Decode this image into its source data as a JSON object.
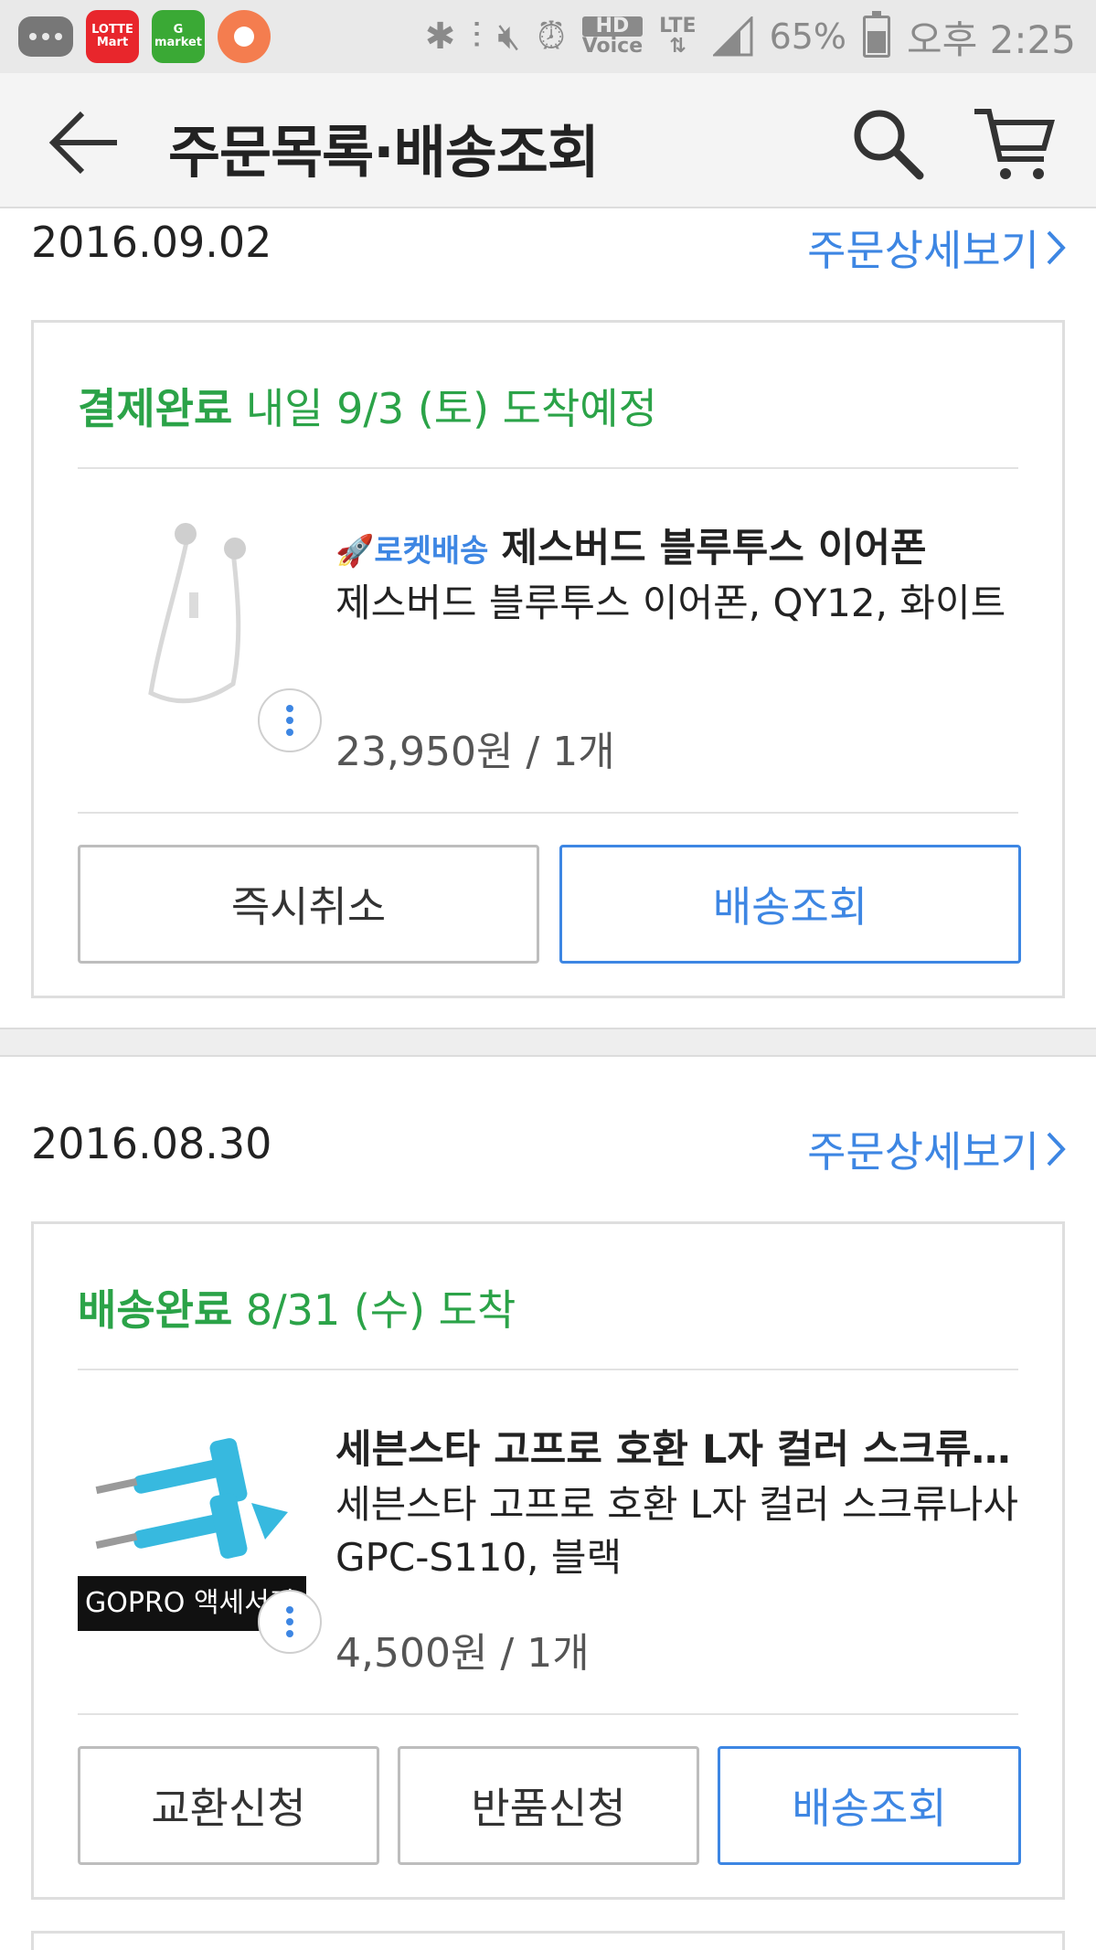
{
  "status_bar": {
    "apps": [
      {
        "name": "chat-app",
        "label": ""
      },
      {
        "name": "lotte-mart-app",
        "label": "LOTTE Mart",
        "color": "#e8262c"
      },
      {
        "name": "gmarket-app",
        "label": "G market",
        "color": "#3aa935"
      },
      {
        "name": "record-app",
        "label": "",
        "color": "#f47d4f"
      }
    ],
    "hd_label": "HD",
    "voice_label": "Voice",
    "lte_label": "LTE",
    "battery": "65%",
    "time": "오후 2:25"
  },
  "header": {
    "title": "주문목록·배송조회",
    "back_icon": "arrow-left-icon",
    "search_icon": "search-icon",
    "cart_icon": "cart-icon"
  },
  "orders": [
    {
      "date": "2016.09.02",
      "detail_link": "주문상세보기",
      "status_label": "결제완료",
      "status_text": "내일 9/3 (토) 도착예정",
      "badge": "🚀로켓배송",
      "product_title": "제스버드 블루투스 이어폰",
      "product_option": "제스버드 블루투스 이어폰, QY12, 화이트",
      "price": "23,950원 / 1개",
      "buttons": [
        "즉시취소",
        "배송조회"
      ]
    },
    {
      "date": "2016.08.30",
      "detail_link": "주문상세보기",
      "status_label": "배송완료",
      "status_text": "8/31 (수) 도착",
      "product_title": "세븐스타 고프로 호환 L자 컬러 스크류나사 GPC-S110, 블랙",
      "product_option": "세븐스타 고프로 호환 L자 컬러 스크류나사 GPC-S110, 블랙",
      "image_caption": "GOPRO 액세서리",
      "price": "4,500원 / 1개",
      "buttons": [
        "교환신청",
        "반품신청",
        "배송조회"
      ]
    }
  ],
  "colors": {
    "accent_blue": "#3d86e3",
    "status_green": "#2ba348"
  }
}
